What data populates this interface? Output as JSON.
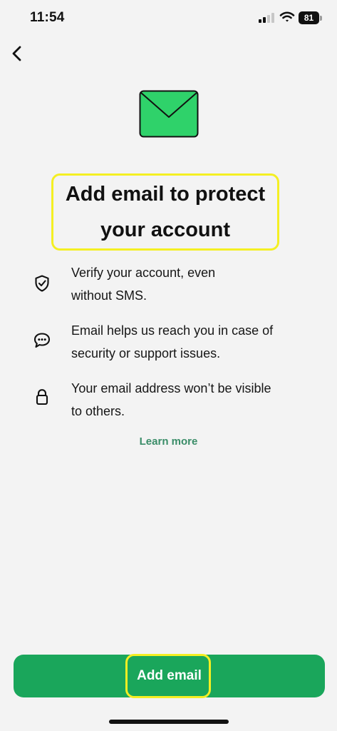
{
  "status_bar": {
    "time": "11:54",
    "battery": "81",
    "icons": [
      "signal-icon",
      "wifi-icon",
      "battery-icon"
    ]
  },
  "navigation": {
    "back_icon": "chevron-left-icon"
  },
  "hero": {
    "icon": "email-envelope-icon",
    "title_line_1": "Add email to protect",
    "title_line_2": "your account"
  },
  "features": [
    {
      "icon": "shield-check-icon",
      "text_line_1": "Verify your account, even",
      "text_line_2": "without SMS."
    },
    {
      "icon": "chat-bubble-icon",
      "text_line_1": "Email helps us reach you in case of",
      "text_line_2": "security or support issues."
    },
    {
      "icon": "lock-icon",
      "text_line_1": "Your email address won’t be visible",
      "text_line_2": "to others."
    }
  ],
  "links": {
    "learn_more": "Learn more"
  },
  "actions": {
    "add_email": "Add email"
  },
  "colors": {
    "background": "#f3f3f3",
    "primary_green": "#1aa65b",
    "link_green": "#3a8d68",
    "highlight_yellow": "#f4ef23",
    "envelope_green": "#2fd26a"
  }
}
